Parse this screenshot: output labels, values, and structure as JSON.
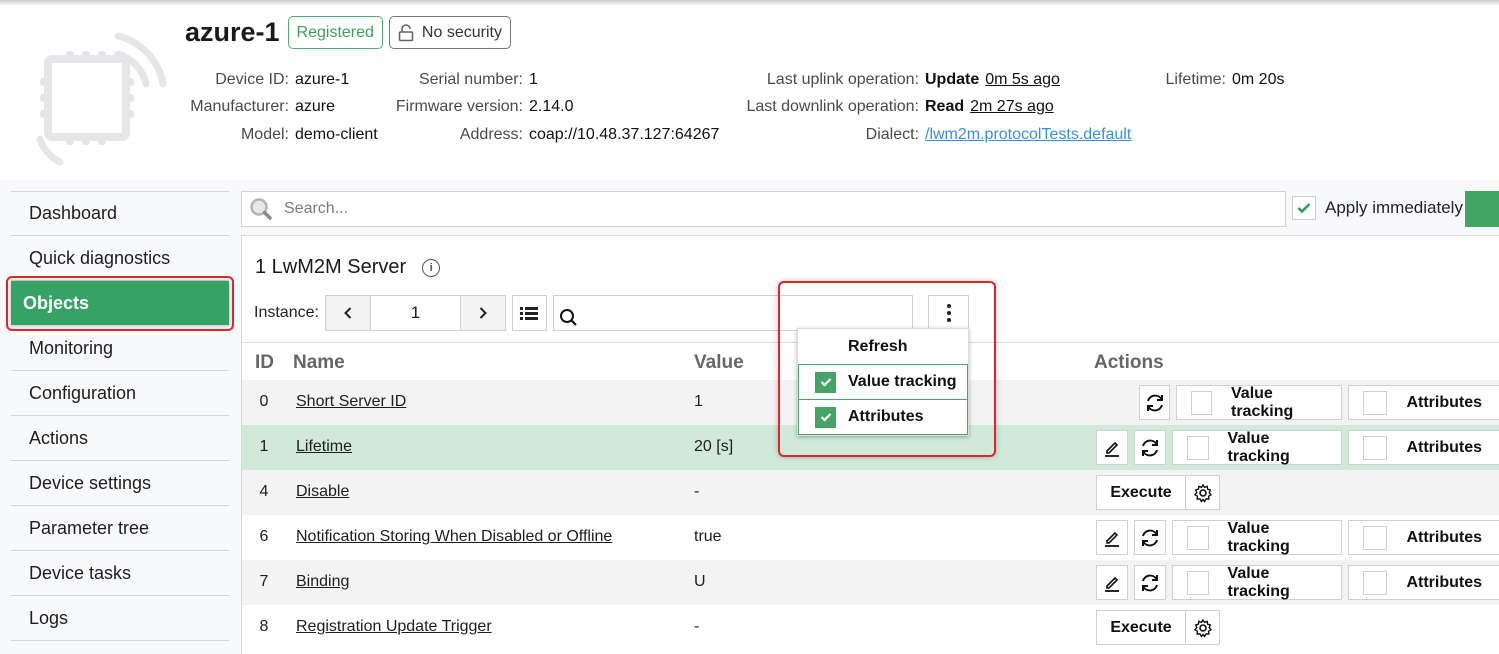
{
  "device": {
    "name": "azure-1",
    "status_badge": "Registered",
    "security_badge": "No security",
    "info": {
      "device_id_label": "Device ID:",
      "device_id": "azure-1",
      "manufacturer_label": "Manufacturer:",
      "manufacturer": "azure",
      "model_label": "Model:",
      "model": "demo-client",
      "serial_label": "Serial number:",
      "serial": "1",
      "firmware_label": "Firmware version:",
      "firmware": "2.14.0",
      "address_label": "Address:",
      "address": "coap://10.48.37.127:64267",
      "uplink_label": "Last uplink operation:",
      "uplink_op": "Update",
      "uplink_time": "0m 5s ago",
      "downlink_label": "Last downlink operation:",
      "downlink_op": "Read",
      "downlink_time": "2m 27s ago",
      "dialect_label": "Dialect:",
      "dialect": "/lwm2m.protocolTests.default",
      "lifetime_label": "Lifetime:",
      "lifetime": "0m 20s"
    }
  },
  "sidebar": {
    "items": [
      {
        "label": "Dashboard"
      },
      {
        "label": "Quick diagnostics"
      },
      {
        "label": "Objects",
        "active": true
      },
      {
        "label": "Monitoring"
      },
      {
        "label": "Configuration"
      },
      {
        "label": "Actions"
      },
      {
        "label": "Device settings"
      },
      {
        "label": "Parameter tree"
      },
      {
        "label": "Device tasks"
      },
      {
        "label": "Logs"
      }
    ]
  },
  "search": {
    "placeholder": "Search...",
    "apply_label": "Apply immediately",
    "apply_checked": true
  },
  "object": {
    "title": "1 LwM2M Server",
    "instance_label": "Instance:",
    "instance_value": "1",
    "columns": {
      "id": "ID",
      "name": "Name",
      "value": "Value",
      "actions": "Actions"
    },
    "menu": {
      "refresh": "Refresh",
      "value_tracking": "Value tracking",
      "value_tracking_checked": true,
      "attributes": "Attributes",
      "attributes_checked": true
    },
    "action_labels": {
      "execute": "Execute",
      "value_tracking": "Value tracking",
      "attributes": "Attributes"
    },
    "rows": [
      {
        "id": "0",
        "name": "Short Server ID",
        "value": "1",
        "type": "readonly"
      },
      {
        "id": "1",
        "name": "Lifetime",
        "value": "20 [s]",
        "type": "rw",
        "highlighted": true
      },
      {
        "id": "4",
        "name": "Disable",
        "value": "-",
        "type": "exec"
      },
      {
        "id": "6",
        "name": "Notification Storing When Disabled or Offline",
        "value": "true",
        "type": "rw"
      },
      {
        "id": "7",
        "name": "Binding",
        "value": "U",
        "type": "rw"
      },
      {
        "id": "8",
        "name": "Registration Update Trigger",
        "value": "-",
        "type": "exec"
      }
    ]
  },
  "colors": {
    "accent": "#37a265",
    "highlight_row": "#d0e9d8",
    "annotation": "#e0242c",
    "link": "#3a8fd8"
  }
}
